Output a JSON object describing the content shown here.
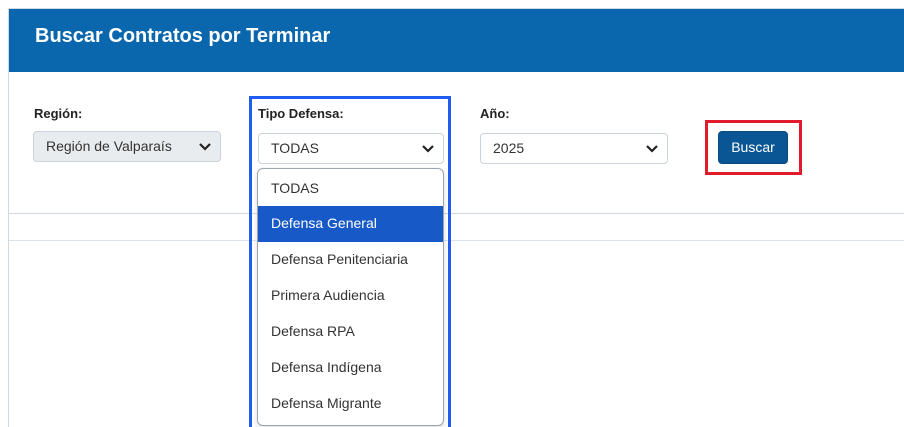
{
  "header": {
    "title": "Buscar Contratos por Terminar"
  },
  "filters": {
    "region": {
      "label": "Región:",
      "value": "Región de Valparaís"
    },
    "tipo_defensa": {
      "label": "Tipo Defensa:",
      "value": "TODAS",
      "options": [
        "TODAS",
        "Defensa General",
        "Defensa Penitenciaria",
        "Primera Audiencia",
        "Defensa RPA",
        "Defensa Indígena",
        "Defensa Migrante"
      ],
      "highlighted_option": 1
    },
    "anio": {
      "label": "Año:",
      "value": "2025"
    }
  },
  "actions": {
    "buscar_label": "Buscar"
  },
  "colors": {
    "header_bg": "#0a67ae",
    "button_bg": "#0a5694",
    "selected_option_bg": "#1659c7",
    "highlight_blue": "#1f5cf0",
    "highlight_red": "#e11b2c"
  },
  "icons": {
    "select_chevron": "chevron-down-icon"
  }
}
